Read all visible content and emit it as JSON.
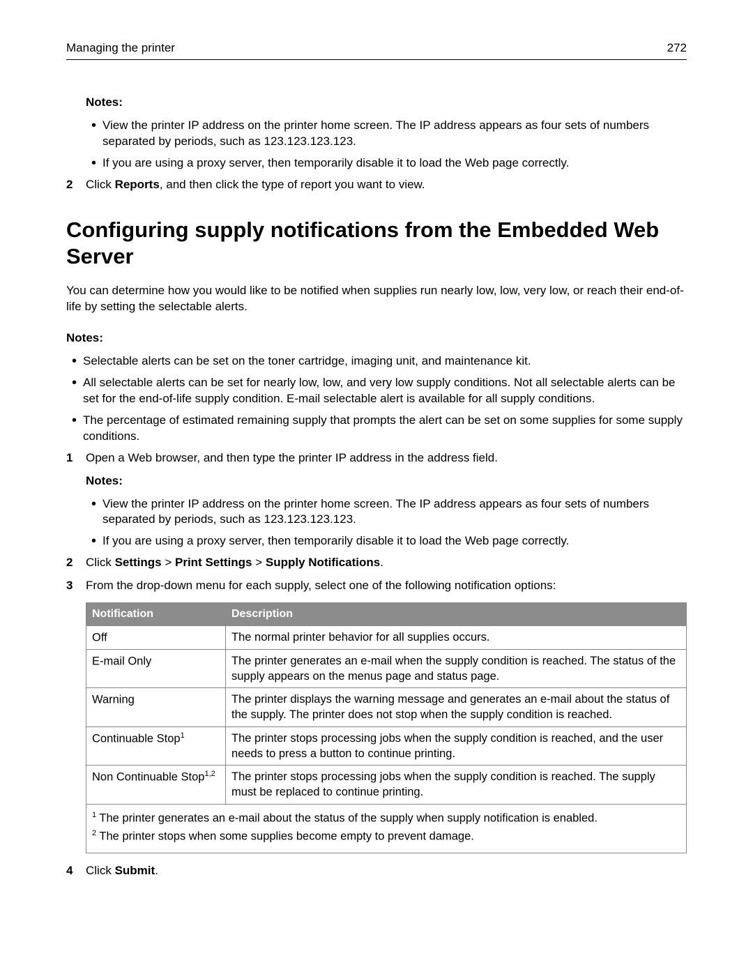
{
  "header": {
    "title": "Managing the printer",
    "page": "272"
  },
  "top": {
    "notes_label": "Notes:",
    "bullets": [
      "View the printer IP address on the printer home screen. The IP address appears as four sets of numbers separated by periods, such as 123.123.123.123.",
      "If you are using a proxy server, then temporarily disable it to load the Web page correctly."
    ],
    "step2_num": "2",
    "step2_pre": "Click ",
    "step2_bold": "Reports",
    "step2_post": ", and then click the type of report you want to view."
  },
  "section": {
    "title": "Configuring supply notifications from the Embedded Web Server",
    "intro": "You can determine how you would like to be notified when supplies run nearly low, low, very low, or reach their end-of-life by setting the selectable alerts.",
    "notes_label": "Notes:",
    "bullets": [
      "Selectable alerts can be set on the toner cartridge, imaging unit, and maintenance kit.",
      "All selectable alerts can be set for nearly low, low, and very low supply conditions. Not all selectable alerts can be set for the end-of-life supply condition. E-mail selectable alert is available for all supply conditions.",
      "The percentage of estimated remaining supply that prompts the alert can be set on some supplies for some supply conditions."
    ],
    "step1_num": "1",
    "step1_text": "Open a Web browser, and then type the printer IP address in the address field.",
    "step1_notes_label": "Notes:",
    "step1_bullets": [
      "View the printer IP address on the printer home screen. The IP address appears as four sets of numbers separated by periods, such as 123.123.123.123.",
      "If you are using a proxy server, then temporarily disable it to load the Web page correctly."
    ],
    "step2_num": "2",
    "step2_pre": "Click ",
    "step2_b1": "Settings",
    "step2_sep1": " > ",
    "step2_b2": "Print Settings",
    "step2_sep2": " > ",
    "step2_b3": "Supply Notifications",
    "step2_post": ".",
    "step3_num": "3",
    "step3_text": "From the drop-down menu for each supply, select one of the following notification options:",
    "step4_num": "4",
    "step4_pre": "Click ",
    "step4_bold": "Submit",
    "step4_post": "."
  },
  "table": {
    "headers": {
      "col1": "Notification",
      "col2": "Description"
    },
    "rows": [
      {
        "name": "Off",
        "sup": "",
        "desc": "The normal printer behavior for all supplies occurs."
      },
      {
        "name": "E-mail Only",
        "sup": "",
        "desc": "The printer generates an e-mail when the supply condition is reached. The status of the supply appears on the menus page and status page."
      },
      {
        "name": "Warning",
        "sup": "",
        "desc": "The printer displays the warning message and generates an e-mail about the status of the supply. The printer does not stop when the supply condition is reached."
      },
      {
        "name": "Continuable Stop",
        "sup": "1",
        "desc": "The printer stops processing jobs when the supply condition is reached, and the user needs to press a button to continue printing."
      },
      {
        "name": "Non Continuable Stop",
        "sup": "1,2",
        "desc": "The printer stops processing jobs when the supply condition is reached. The supply must be replaced to continue printing."
      }
    ],
    "footnote1_sup": "1",
    "footnote1": " The printer generates an e-mail about the status of the supply when supply notification is enabled.",
    "footnote2_sup": "2",
    "footnote2": " The printer stops when some supplies become empty to prevent damage."
  }
}
